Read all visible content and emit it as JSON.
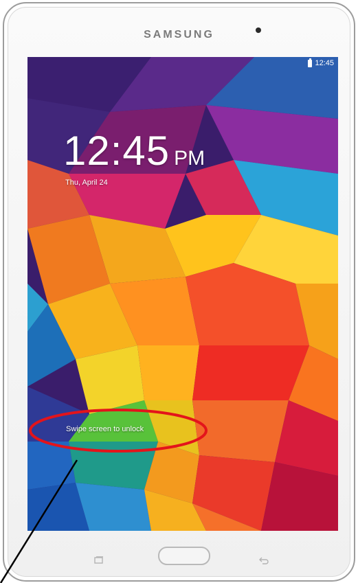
{
  "device": {
    "brand": "SAMSUNG"
  },
  "status_bar": {
    "time": "12:45",
    "battery_icon": "battery-icon"
  },
  "lock_screen": {
    "clock_time": "12:45",
    "clock_ampm": "PM",
    "date": "Thu, April 24",
    "swipe_hint": "Swipe screen to unlock"
  },
  "annotation": {
    "highlight_color": "#e3141b",
    "pointer_color": "#000000"
  },
  "hardware_buttons": {
    "recent_apps_icon": "recent-apps-icon",
    "home_button": "home-button",
    "back_icon": "back-icon"
  }
}
